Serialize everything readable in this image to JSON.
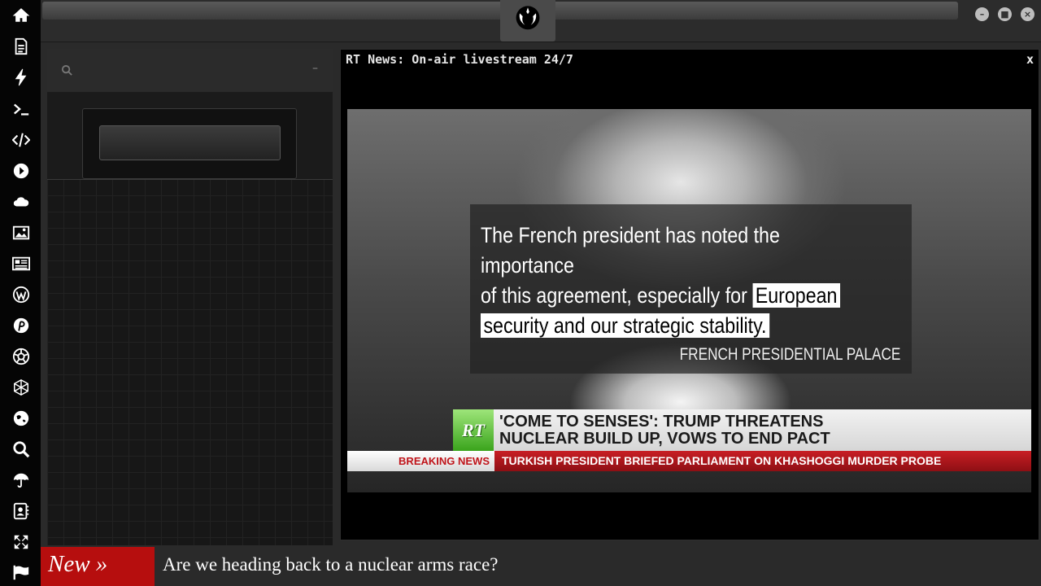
{
  "rail": {
    "icons": [
      "home-icon",
      "document-icon",
      "lightning-icon",
      "terminal-icon",
      "code-icon",
      "play-icon",
      "cloud-icon",
      "image-icon",
      "newspaper-icon",
      "wordpress-icon",
      "pinterest-icon",
      "aperture-icon",
      "network-icon",
      "globe-icon",
      "search-icon",
      "umbrella-icon",
      "contacts-icon",
      "expand-icon",
      "flag-icon"
    ]
  },
  "window": {
    "controls": [
      "minimize",
      "maximize",
      "close"
    ]
  },
  "left_panel": {
    "collapse_label": "–",
    "search_value": ""
  },
  "video_window": {
    "title": "RT News: On-air livestream 24/7",
    "close_label": "x",
    "quote": {
      "line1": "The French president has noted the importance",
      "line2_pre": "of this agreement, especially for",
      "line2_hl": "European",
      "line3_hl": "security and our strategic stability."
    },
    "source": "FRENCH PRESIDENTIAL PALACE",
    "channel_logo": "RT",
    "headline_line1": "'COME TO SENSES': TRUMP THREATENS",
    "headline_line2": "NUCLEAR BUILD UP, VOWS TO END PACT",
    "ticker_label": "BREAKING NEWS",
    "ticker_text": "TURKISH PRESIDENT BRIEFED PARLIAMENT ON KHASHOGGI MURDER PROBE"
  },
  "news_strip": {
    "tag": "New »",
    "text": "Are we heading back to a nuclear arms race?"
  },
  "colors": {
    "news_tag": "#b60e0e",
    "ticker_red": "#c81e24",
    "rt_green": "#5cc02e"
  }
}
